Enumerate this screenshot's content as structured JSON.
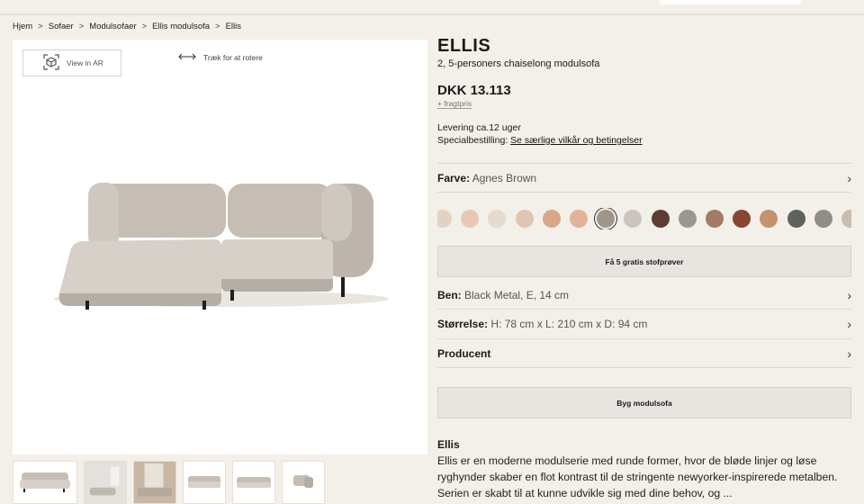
{
  "breadcrumb": [
    "Hjem",
    "Sofaer",
    "Modulsofaer",
    "Ellis modulsofa",
    "Ellis"
  ],
  "gallery": {
    "ar_label": "View in AR",
    "rotate_hint": "Træk for at rotere"
  },
  "product": {
    "name": "ELLIS",
    "subtitle": "2, 5-personers chaiselong modulsofa",
    "price": "DKK 13.113",
    "freight": "+ fragtpris",
    "delivery": "Levering ca.12 uger",
    "special_label": "Specialbestilling:",
    "special_link": "Se særlige vilkår og betingelser"
  },
  "options": {
    "color_label": "Farve:",
    "color_value": "Agnes Brown",
    "legs_label": "Ben:",
    "legs_value": "Black Metal, E, 14 cm",
    "size_label": "Størrelse:",
    "size_value": "H: 78 cm x L: 210 cm x D: 94 cm",
    "maker_label": "Producent"
  },
  "swatch_colors": [
    "#e2d2c3",
    "#e8c8b3",
    "#e3dbd0",
    "#dec6b2",
    "#d8a78a",
    "#e0b396",
    "#a19489",
    "#cbc5bd",
    "#5e3c33",
    "#9d9690",
    "#a47b62",
    "#874633",
    "#c2936c",
    "#5f6360",
    "#8f8d88",
    "#cbbcae"
  ],
  "selected_swatch": 6,
  "buttons": {
    "samples": "Få 5 gratis stofprøver",
    "build": "Byg modulsofa"
  },
  "description": {
    "title": "Ellis",
    "text": "Ellis er en moderne modulserie med runde former, hvor de bløde linjer og løse ryghynder skaber en flot kontrast til de stringente newyorker-inspirerede metalben. Serien er skabt til at kunne udvikle sig med dine behov, og ..."
  },
  "colors": {
    "background": "#f3efe9",
    "button": "#e8e4df",
    "fabric": "#c9c2ba"
  }
}
